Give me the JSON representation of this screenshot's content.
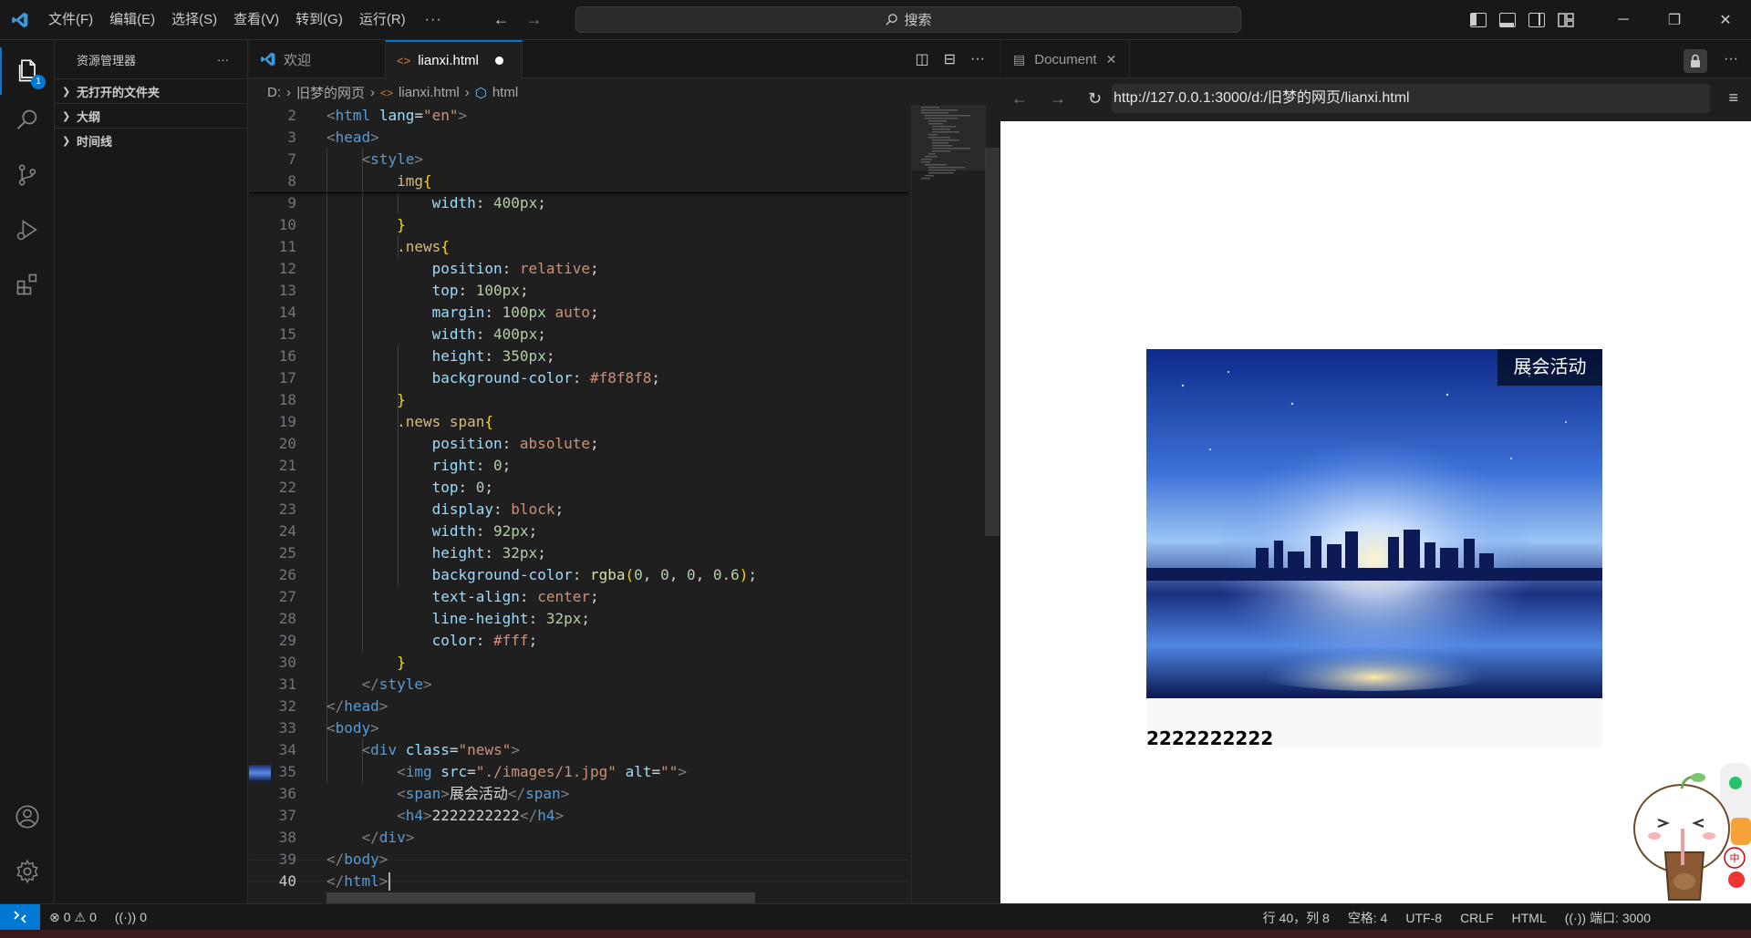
{
  "titlebar": {
    "menus": [
      "文件(F)",
      "编辑(E)",
      "选择(S)",
      "查看(V)",
      "转到(G)",
      "运行(R)"
    ],
    "more": "···",
    "search_placeholder": "搜索"
  },
  "activitybar": {
    "explorer_badge": "1",
    "icons": [
      "explorer-icon",
      "search-icon",
      "source-control-icon",
      "run-debug-icon",
      "extensions-icon",
      "account-icon",
      "settings-gear-icon"
    ]
  },
  "sidebar": {
    "title": "资源管理器",
    "more": "···",
    "sections": [
      "无打开的文件夹",
      "大纲",
      "时间线"
    ]
  },
  "tabs": [
    {
      "label": "欢迎",
      "icon": "vscode-icon"
    },
    {
      "label": "lianxi.html",
      "icon": "html-icon",
      "modified": true
    }
  ],
  "breadcrumb": [
    "D:",
    "旧梦的网页",
    "lianxi.html",
    "html"
  ],
  "editor": {
    "current_line": "40",
    "line_numbers": [
      "2",
      "3",
      "7",
      "8",
      "9",
      "10",
      "11",
      "12",
      "13",
      "14",
      "15",
      "16",
      "17",
      "18",
      "19",
      "20",
      "21",
      "22",
      "23",
      "24",
      "25",
      "26",
      "27",
      "28",
      "29",
      "30",
      "31",
      "32",
      "33",
      "34",
      "35",
      "36",
      "37",
      "38",
      "39",
      "40"
    ]
  },
  "preview": {
    "tab_label": "Document",
    "url": "http://127.0.0.1:3000/d:/旧梦的网页/lianxi.html",
    "news_label": "展会活动",
    "news_title": "2222222222",
    "ime_indicator": "中"
  },
  "statusbar": {
    "errors": "0",
    "warnings": "0",
    "ports_left": "0",
    "position": "行 40，列 8",
    "spaces": "空格: 4",
    "encoding": "UTF-8",
    "eol": "CRLF",
    "language": "HTML",
    "port": "端口: 3000"
  },
  "colors": {
    "accent": "#0078d4",
    "editor_bg": "#1f1f1f",
    "chrome_bg": "#181818"
  }
}
